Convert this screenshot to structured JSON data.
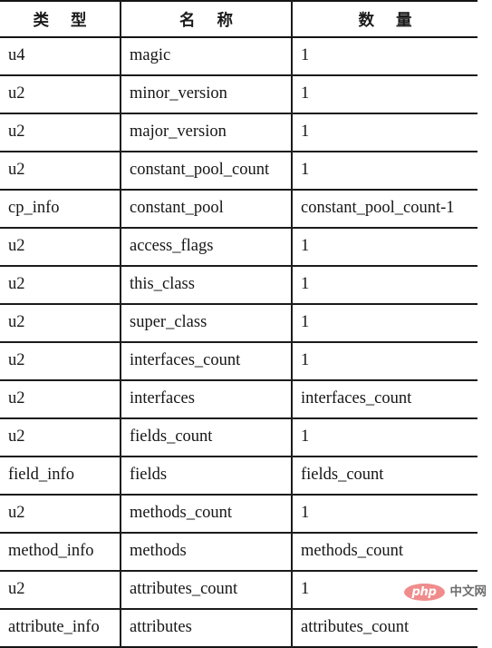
{
  "table": {
    "headers": [
      "类 型",
      "名 称",
      "数 量"
    ],
    "rows": [
      {
        "type": "u4",
        "name": "magic",
        "count": "1"
      },
      {
        "type": "u2",
        "name": "minor_version",
        "count": "1"
      },
      {
        "type": "u2",
        "name": "major_version",
        "count": "1"
      },
      {
        "type": "u2",
        "name": "constant_pool_count",
        "count": "1"
      },
      {
        "type": "cp_info",
        "name": "constant_pool",
        "count": "constant_pool_count-1"
      },
      {
        "type": "u2",
        "name": "access_flags",
        "count": "1"
      },
      {
        "type": "u2",
        "name": "this_class",
        "count": "1"
      },
      {
        "type": "u2",
        "name": "super_class",
        "count": "1"
      },
      {
        "type": "u2",
        "name": "interfaces_count",
        "count": "1"
      },
      {
        "type": "u2",
        "name": "interfaces",
        "count": "interfaces_count"
      },
      {
        "type": "u2",
        "name": "fields_count",
        "count": "1"
      },
      {
        "type": "field_info",
        "name": "fields",
        "count": "fields_count"
      },
      {
        "type": "u2",
        "name": "methods_count",
        "count": "1"
      },
      {
        "type": "method_info",
        "name": "methods",
        "count": "methods_count"
      },
      {
        "type": "u2",
        "name": "attributes_count",
        "count": "1"
      },
      {
        "type": "attribute_info",
        "name": "attributes",
        "count": "attributes_count"
      }
    ]
  },
  "watermark": {
    "badge_text": "php",
    "site_text": "中文网",
    "badge_color": "#f08c8c",
    "site_color": "#6d6d6d"
  }
}
